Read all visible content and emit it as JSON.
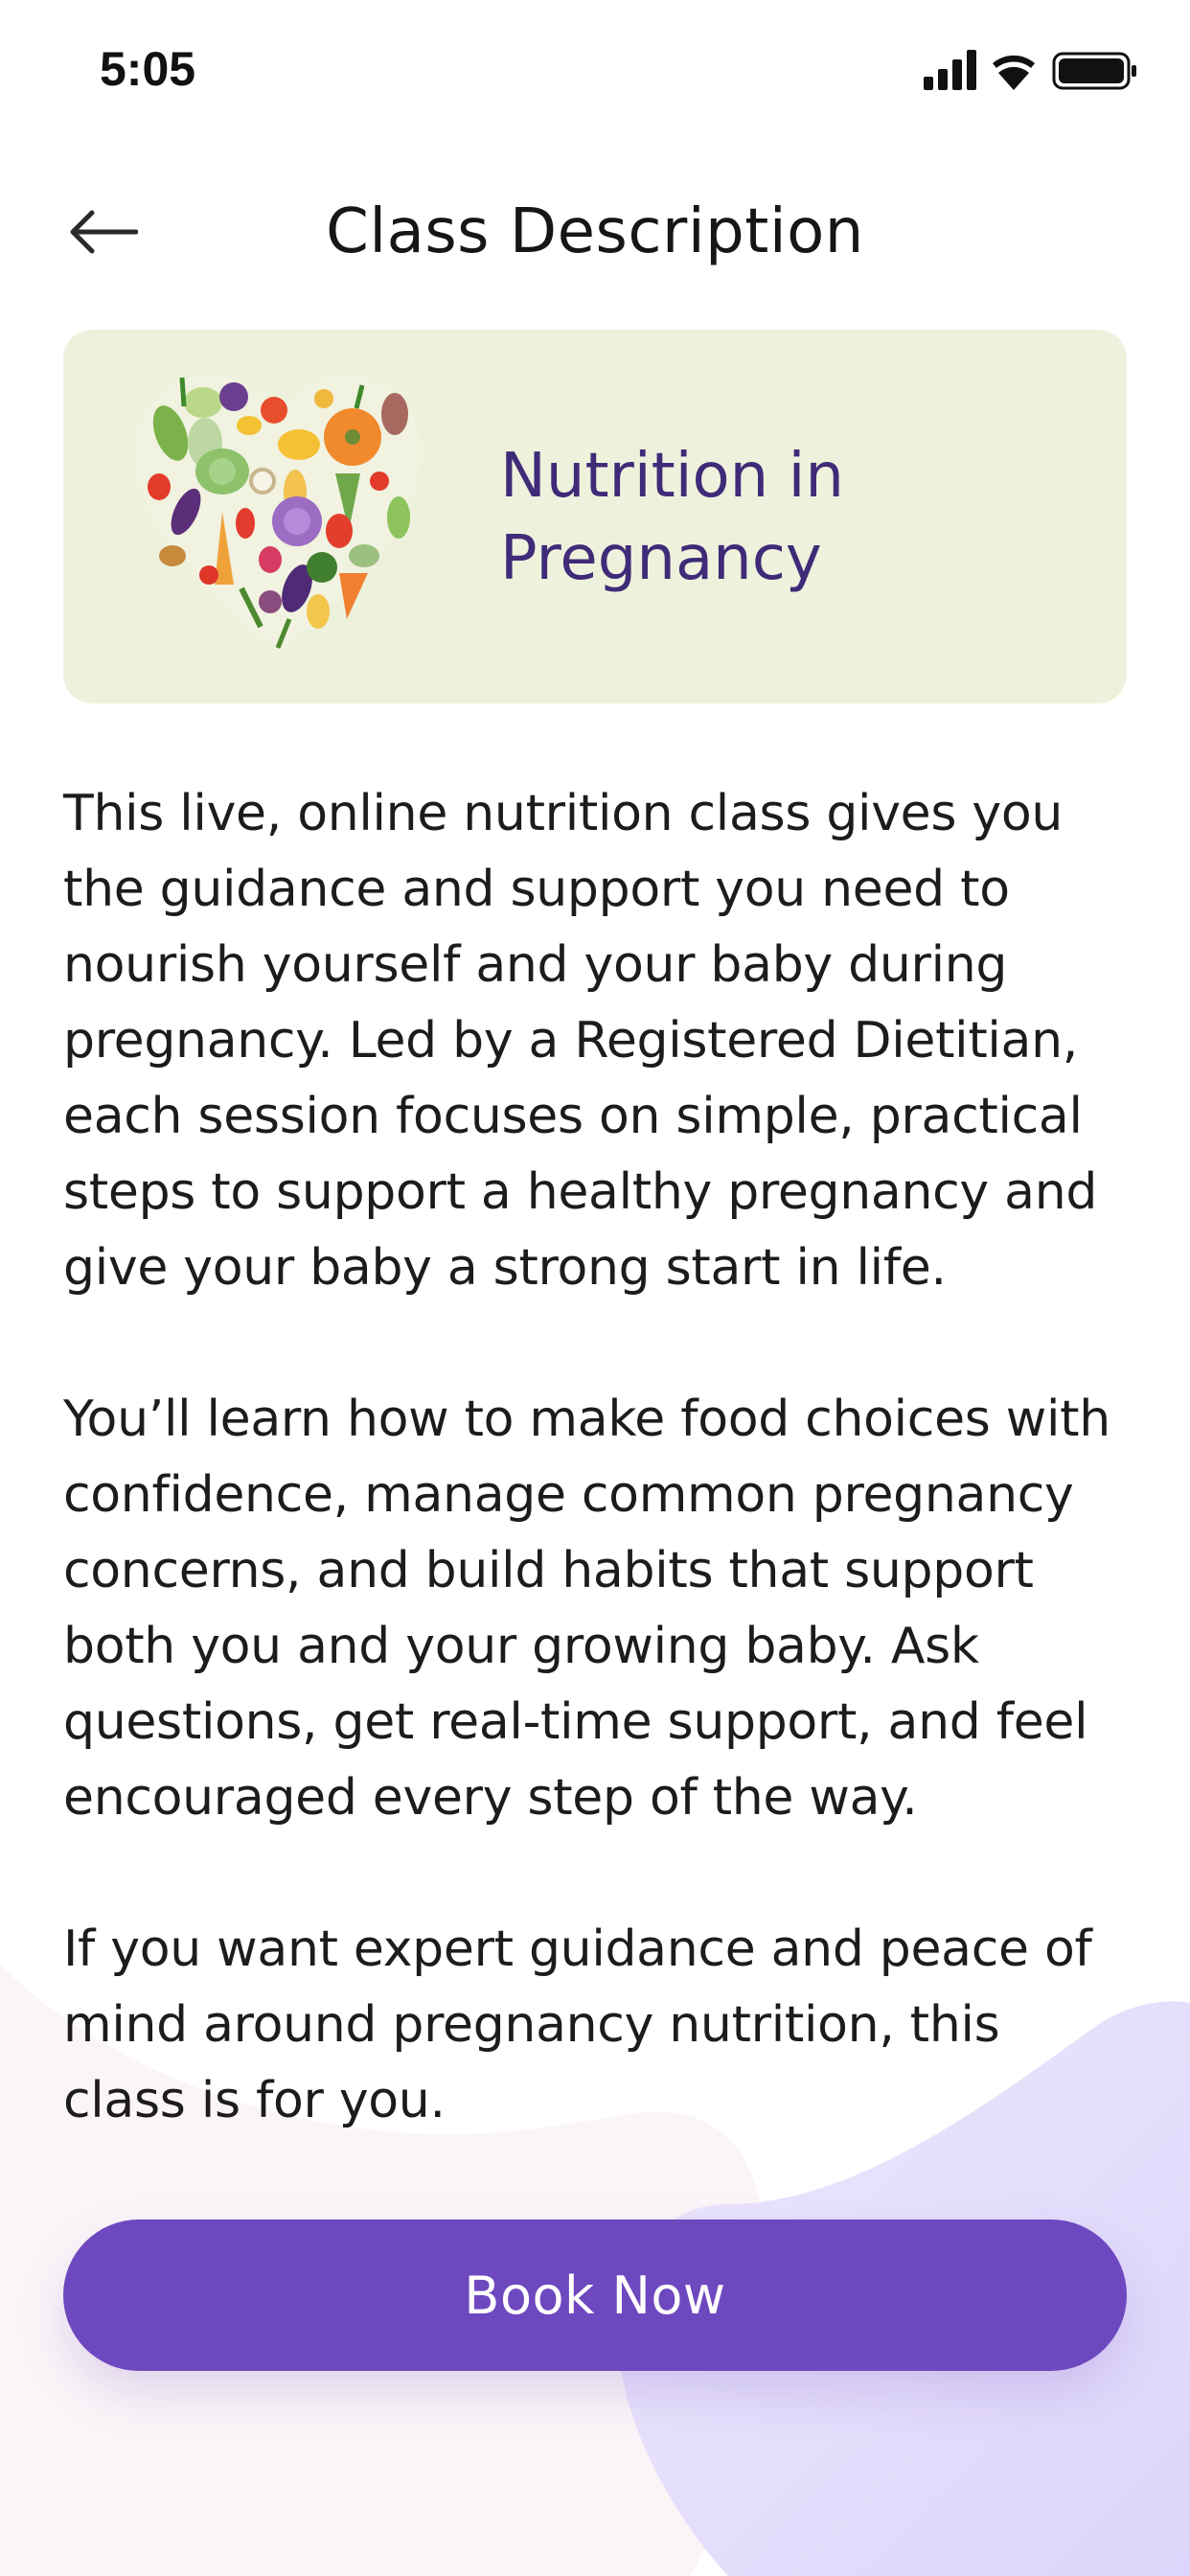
{
  "status_bar": {
    "time": "5:05",
    "icons": [
      "cellular-signal-icon",
      "wifi-icon",
      "battery-icon"
    ]
  },
  "header": {
    "back_icon": "arrow-left-icon",
    "title": "Class Description"
  },
  "hero": {
    "image": "vegetable-heart-illustration",
    "title": "Nutrition in Pregnancy",
    "background_color": "#eef2dd",
    "title_color": "#3f2b78"
  },
  "description": {
    "paragraphs": [
      "This live, online nutrition class gives you the guidance and support you need to nourish yourself and your baby during pregnancy. Led by a Registered Dietitian, each session focuses on simple, practical steps to support a healthy pregnancy and give your baby a strong start in life.",
      "You’ll learn how to make food choices with confidence, manage common pregnancy concerns, and build habits that support both you and your growing baby. Ask questions, get real-time support, and feel encouraged every step of the way.",
      "If you want expert guidance and peace of mind around pregnancy nutrition, this class is for you."
    ]
  },
  "actions": {
    "book_label": "Book Now",
    "accent_color": "#6e48bf"
  }
}
